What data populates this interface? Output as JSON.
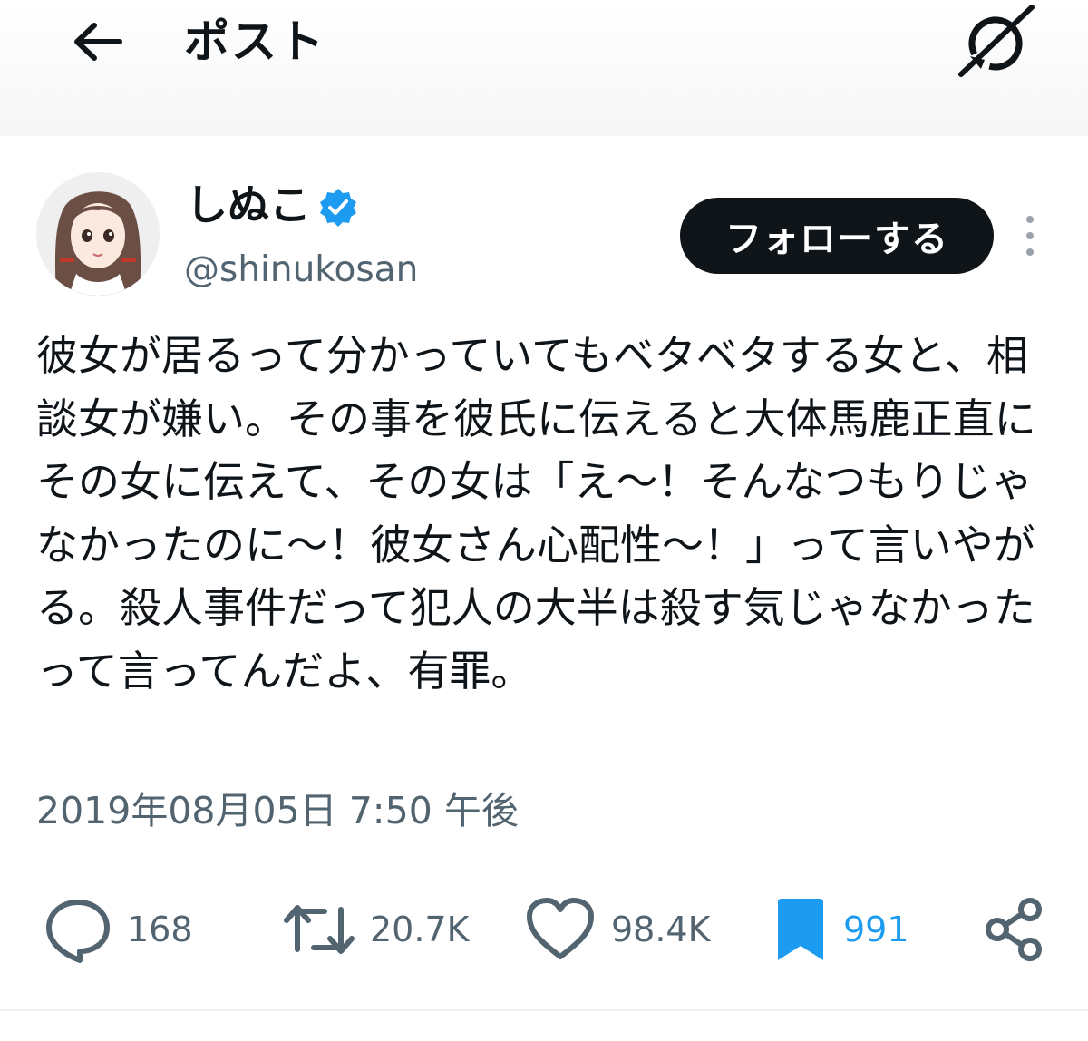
{
  "header": {
    "back_icon": "arrow-left-icon",
    "title": "ポスト",
    "app_icon": "grok-icon"
  },
  "author": {
    "display_name": "しぬこ",
    "verified": true,
    "verified_color": "#1d9bf0",
    "handle": "@shinukosan",
    "follow_label": "フォローする",
    "more_icon": "more-vertical-icon"
  },
  "tweet": {
    "text": "彼女が居るって分かっていてもベタベタする女と、相談女が嫌い。その事を彼氏に伝えると大体馬鹿正直にその女に伝えて、その女は「え〜！そんなつもりじゃなかったのに〜！彼女さん心配性〜！」って言いやがる。殺人事件だって犯人の大半は殺す気じゃなかったって言ってんだよ、有罪。",
    "timestamp": "2019年08月05日 7:50 午後"
  },
  "actions": {
    "reply": {
      "icon": "reply-icon",
      "count": "168"
    },
    "repost": {
      "icon": "repost-icon",
      "count": "20.7K"
    },
    "like": {
      "icon": "heart-icon",
      "count": "98.4K"
    },
    "bookmark": {
      "icon": "bookmark-icon",
      "count": "991",
      "active": true,
      "color": "#1d9bf0"
    },
    "share": {
      "icon": "share-icon"
    }
  }
}
